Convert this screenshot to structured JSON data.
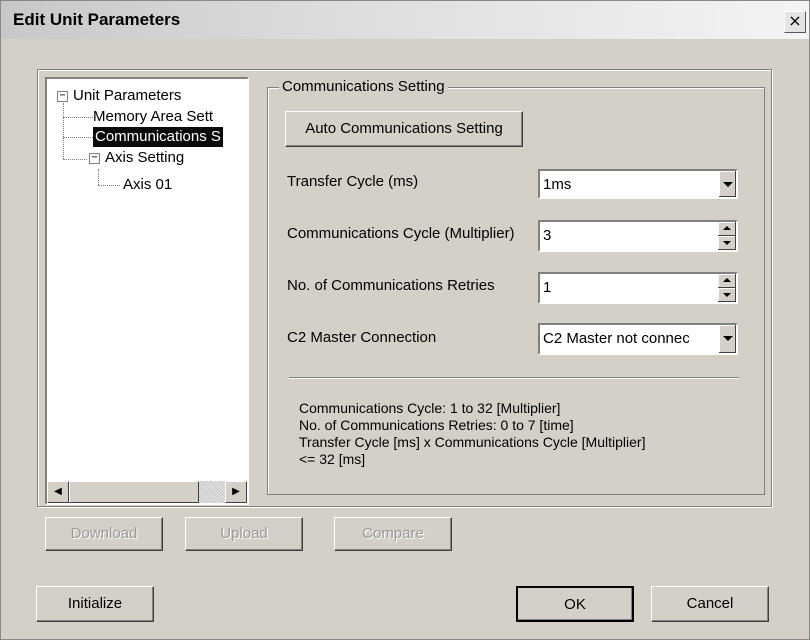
{
  "window": {
    "title": "Edit Unit Parameters",
    "close_glyph": "×"
  },
  "tree": {
    "root": "Unit Parameters",
    "memory": "Memory Area Sett",
    "communications": "Communications S",
    "axis_setting": "Axis Setting",
    "axis01": "Axis 01",
    "expander_glyph": "−",
    "scroll_left": "◀",
    "scroll_right": "▶"
  },
  "group": {
    "title": "Communications Setting",
    "auto_button": "Auto Communications Setting",
    "transfer_cycle": {
      "label": "Transfer Cycle (ms)",
      "value": "1ms"
    },
    "comm_cycle": {
      "label": "Communications Cycle (Multiplier)",
      "value": "3"
    },
    "retries": {
      "label": "No. of Communications Retries",
      "value": "1"
    },
    "c2_master": {
      "label": "C2 Master Connection",
      "value": "C2 Master not connec"
    },
    "notes": [
      "Communications Cycle: 1 to 32 [Multiplier]",
      "No. of Communications Retries: 0 to 7 [time]",
      "Transfer Cycle [ms] x Communications Cycle [Multiplier]",
      "<= 32 [ms]"
    ]
  },
  "buttons": {
    "download": "Download",
    "upload": "Upload",
    "compare": "Compare",
    "initialize": "Initialize",
    "ok": "OK",
    "cancel": "Cancel"
  }
}
